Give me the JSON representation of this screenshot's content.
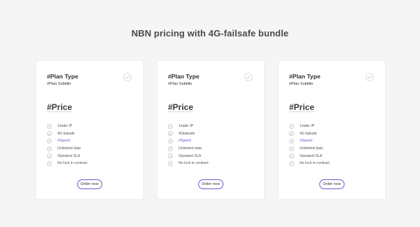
{
  "page": {
    "title": "NBN pricing with 4G-failsafe bundle"
  },
  "colors": {
    "accent": "#6a5acd"
  },
  "cards": [
    {
      "plan_type": "#Plan Type",
      "plan_subtitle": "#Plan Subtitle",
      "price": "#Price",
      "features": [
        "1static IP",
        "4G failsafe",
        "#Speed",
        "Unlimited data",
        "Standard SLA",
        "No lock in contract"
      ],
      "order_label": "Order now"
    },
    {
      "plan_type": "#Plan Type",
      "plan_subtitle": "#Plan Subtitle",
      "price": "#Price",
      "features": [
        "1static IP",
        "4Gfailsafe",
        "#Speed",
        "Unlimited data",
        "Standard SLA",
        "No lock in contract"
      ],
      "order_label": "Order now"
    },
    {
      "plan_type": "#Plan Type",
      "plan_subtitle": "#Plan Subtitle",
      "price": "#Price",
      "features": [
        "1static IP",
        "4G failsafe",
        "#Speed",
        "Unlimited data",
        "Standard SLA",
        "No lock in contract"
      ],
      "order_label": "Order now"
    }
  ],
  "icons": {
    "check": "check-circle-icon",
    "select": "select-circle-icon"
  }
}
